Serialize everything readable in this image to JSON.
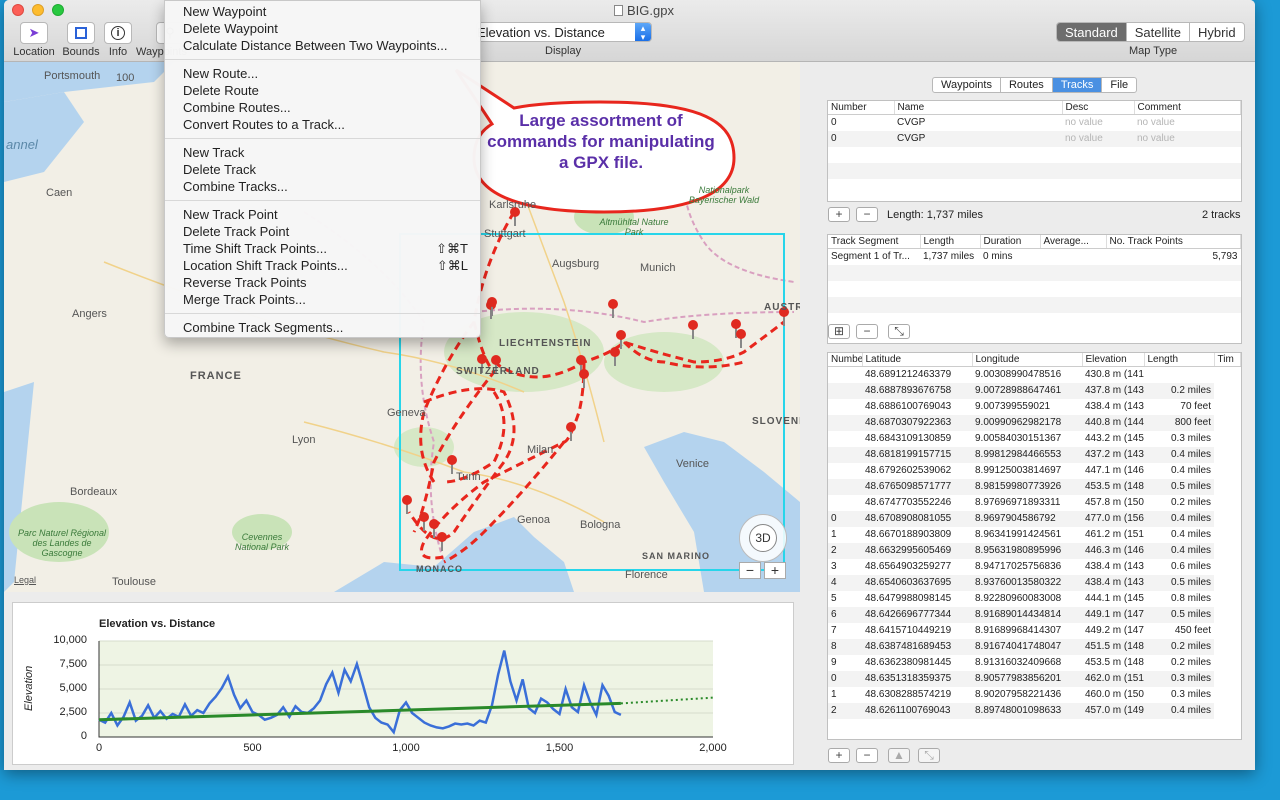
{
  "window": {
    "title": "BIG.gpx"
  },
  "toolbar": {
    "location": "Location",
    "bounds": "Bounds",
    "info": "Info",
    "waypoints": "Waypoints",
    "display_value": "Elevation vs. Distance",
    "display_label": "Display",
    "map_type_label": "Map Type",
    "map_types": [
      "Standard",
      "Satellite",
      "Hybrid"
    ],
    "map_type_selected": "Standard"
  },
  "menu": {
    "items": [
      {
        "label": "New Waypoint",
        "shortcut": ""
      },
      {
        "label": "Delete Waypoint",
        "shortcut": ""
      },
      {
        "label": "Calculate Distance Between Two Waypoints...",
        "shortcut": ""
      },
      {
        "label": "New Route...",
        "shortcut": ""
      },
      {
        "label": "Delete Route",
        "shortcut": ""
      },
      {
        "label": "Combine Routes...",
        "shortcut": ""
      },
      {
        "label": "Convert Routes to a Track...",
        "shortcut": ""
      },
      {
        "label": "New Track",
        "shortcut": ""
      },
      {
        "label": "Delete Track",
        "shortcut": ""
      },
      {
        "label": "Combine Tracks...",
        "shortcut": ""
      },
      {
        "label": "New Track Point",
        "shortcut": ""
      },
      {
        "label": "Delete Track Point",
        "shortcut": ""
      },
      {
        "label": "Time Shift Track Points...",
        "shortcut": "⇧⌘T"
      },
      {
        "label": "Location Shift Track Points...",
        "shortcut": "⇧⌘L"
      },
      {
        "label": "Reverse Track Points",
        "shortcut": ""
      },
      {
        "label": "Merge Track Points...",
        "shortcut": ""
      },
      {
        "label": "Combine Track Segments...",
        "shortcut": ""
      }
    ]
  },
  "callout": {
    "line1": "Large assortment of",
    "line2": "commands for manipulating",
    "line3": "a GPX file."
  },
  "map": {
    "labels": {
      "portsouth": "Portsmouth",
      "scale_100": "100",
      "channel": "annel",
      "caen": "Caen",
      "angers": "Angers",
      "france": "FRANCE",
      "lyon": "Lyon",
      "bordeaux": "Bordeaux",
      "toulouse": "Toulouse",
      "legal": "Legal",
      "park_landes": "Parc Naturel Régional des Landes de Gascogne",
      "park_cevennes": "Cevennes National Park",
      "stuttgart": "Stuttgart",
      "karlsruhe": "Karlsruhe",
      "augsburg": "Augsburg",
      "munich": "Munich",
      "liechtenstein": "LIECHTENSTEIN",
      "switzerland": "SWITZERLAND",
      "geneva": "Geneva",
      "turin": "Turin",
      "milan": "Milan",
      "genoa": "Genoa",
      "bologna": "Bologna",
      "venice": "Venice",
      "florence": "Florence",
      "san_marino": "SAN MARINO",
      "monaco": "MONACO",
      "slovenia": "SLOVENI",
      "austria": "AUSTR",
      "park_altmuhltal": "Altmühltal Nature Park",
      "park_bayerischer": "Nationalpark Bayerischer Wald",
      "compass_3d": "3D",
      "zoom_out": "−",
      "zoom_in": "+"
    }
  },
  "chart_data": {
    "type": "line",
    "title": "Elevation vs. Distance",
    "xlabel": "",
    "ylabel": "Elevation",
    "xlim": [
      0,
      2000
    ],
    "ylim": [
      0,
      10000
    ],
    "x_ticks": [
      "0",
      "500",
      "1,000",
      "1,500",
      "2,000"
    ],
    "y_ticks": [
      "10,000",
      "7,500",
      "5,000",
      "2,500",
      "0"
    ],
    "series": [
      {
        "color": "#3a6fd8",
        "x": [
          0,
          20,
          40,
          60,
          80,
          100,
          120,
          140,
          160,
          180,
          200,
          220,
          240,
          260,
          280,
          300,
          320,
          340,
          360,
          380,
          400,
          420,
          440,
          460,
          480,
          500,
          520,
          540,
          560,
          580,
          600,
          620,
          640,
          660,
          680,
          700,
          720,
          740,
          760,
          780,
          800,
          820,
          840,
          860,
          880,
          900,
          920,
          940,
          960,
          980,
          1000,
          1020,
          1040,
          1060,
          1080,
          1100,
          1120,
          1140,
          1160,
          1180,
          1200,
          1220,
          1240,
          1260,
          1280,
          1300,
          1320,
          1340,
          1360,
          1380,
          1400,
          1420,
          1440,
          1460,
          1480,
          1500,
          1520,
          1540,
          1560,
          1580,
          1600,
          1620,
          1640,
          1660,
          1680,
          1700
        ],
        "values": [
          1800,
          1500,
          2500,
          1200,
          2100,
          3600,
          1700,
          2200,
          3300,
          2000,
          2700,
          1900,
          2400,
          2100,
          3400,
          2200,
          2800,
          2500,
          3500,
          4200,
          5100,
          6300,
          4400,
          3000,
          3800,
          2600,
          2300,
          1800,
          2000,
          2300,
          3100,
          2100,
          3200,
          2600,
          2500,
          3000,
          3800,
          5500,
          6700,
          4600,
          7000,
          5800,
          7600,
          5400,
          3100,
          2000,
          1500,
          1300,
          500,
          2800,
          3600,
          2500,
          2000,
          1500,
          1200,
          1000,
          900,
          1100,
          1400,
          1300,
          1400,
          1200,
          1700,
          1500,
          3300,
          6500,
          9000,
          5800,
          3800,
          6000,
          3000,
          2500,
          4000,
          3600,
          2900,
          2400,
          5000,
          3100,
          2600,
          5400,
          3600,
          2300,
          5400,
          4300,
          2600,
          2300
        ]
      },
      {
        "color": "#2a8a2a",
        "x": [
          0,
          1700
        ],
        "values": [
          1800,
          3500
        ]
      }
    ],
    "trend_extension": {
      "x": [
        1700,
        2000
      ],
      "values": [
        3500,
        4100
      ]
    }
  },
  "right": {
    "tabs": [
      "Waypoints",
      "Routes",
      "Tracks",
      "File"
    ],
    "tab_selected": "Tracks",
    "tracks_table": {
      "headers": [
        "Number",
        "Name",
        "Desc",
        "Comment"
      ],
      "rows": [
        [
          "0",
          "CVGP",
          "no value",
          "no value"
        ],
        [
          "0",
          "CVGP",
          "no value",
          "no value"
        ]
      ]
    },
    "track_length": "Length: 1,737 miles",
    "track_count": "2 tracks",
    "segments_table": {
      "headers": [
        "Track Segment",
        "Length",
        "Duration",
        "Average...",
        "No. Track Points"
      ],
      "rows": [
        [
          "Segment 1 of Tr...",
          "1,737 miles",
          "0 mins",
          "",
          "5,793"
        ]
      ]
    },
    "points_table": {
      "headers": [
        "Number",
        "Latitude",
        "Longitude",
        "Elevation",
        "Length",
        "Tim"
      ],
      "rows": [
        [
          "",
          "48.6891212463379",
          "9.00308990478516",
          "430.8 m (141...",
          ""
        ],
        [
          "",
          "48.6887893676758",
          "9.00728988647461",
          "437.8 m (143...",
          "0.2 miles"
        ],
        [
          "",
          "48.6886100769043",
          "9.007399559021",
          "438.4 m (143...",
          "70 feet"
        ],
        [
          "",
          "48.6870307922363",
          "9.00990962982178",
          "440.8 m (144...",
          "800 feet"
        ],
        [
          "",
          "48.6843109130859",
          "9.00584030151367",
          "443.2 m (145...",
          "0.3 miles"
        ],
        [
          "",
          "48.6818199157715",
          "8.99812984466553",
          "437.2 m (143...",
          "0.4 miles"
        ],
        [
          "",
          "48.6792602539062",
          "8.99125003814697",
          "447.1 m (146...",
          "0.4 miles"
        ],
        [
          "",
          "48.6765098571777",
          "8.98159980773926",
          "453.5 m (148...",
          "0.5 miles"
        ],
        [
          "",
          "48.6747703552246",
          "8.97696971893311",
          "457.8 m (150...",
          "0.2 miles"
        ],
        [
          "0",
          "48.6708908081055",
          "8.9697904586792",
          "477.0 m (156...",
          "0.4 miles"
        ],
        [
          "1",
          "48.6670188903809",
          "8.96341991424561",
          "461.2 m (151...",
          "0.4 miles"
        ],
        [
          "2",
          "48.6632995605469",
          "8.95631980895996",
          "446.3 m (146...",
          "0.4 miles"
        ],
        [
          "3",
          "48.6564903259277",
          "8.94717025756836",
          "438.4 m (143...",
          "0.6 miles"
        ],
        [
          "4",
          "48.6540603637695",
          "8.93760013580322",
          "438.4 m (143...",
          "0.5 miles"
        ],
        [
          "5",
          "48.6479988098145",
          "8.92280960083008",
          "444.1 m (145...",
          "0.8 miles"
        ],
        [
          "6",
          "48.6426696777344",
          "8.91689014434814",
          "449.1 m (147...",
          "0.5 miles"
        ],
        [
          "7",
          "48.6415710449219",
          "8.91689968414307",
          "449.2 m (147...",
          "450 feet"
        ],
        [
          "8",
          "48.6387481689453",
          "8.91674041748047",
          "451.5 m (148...",
          "0.2 miles"
        ],
        [
          "9",
          "48.6362380981445",
          "8.91316032409668",
          "453.5 m (148...",
          "0.2 miles"
        ],
        [
          "0",
          "48.6351318359375",
          "8.90577983856201",
          "462.0 m (151...",
          "0.3 miles"
        ],
        [
          "1",
          "48.6308288574219",
          "8.90207958221436",
          "460.0 m (150...",
          "0.3 miles"
        ],
        [
          "2",
          "48.6261100769043",
          "8.89748001098633",
          "457.0 m (149...",
          "0.4 miles"
        ]
      ]
    }
  },
  "colors": {
    "track_red": "#e8261d",
    "selection_cyan": "#27d5ea",
    "accent_blue": "#4a90e2"
  }
}
